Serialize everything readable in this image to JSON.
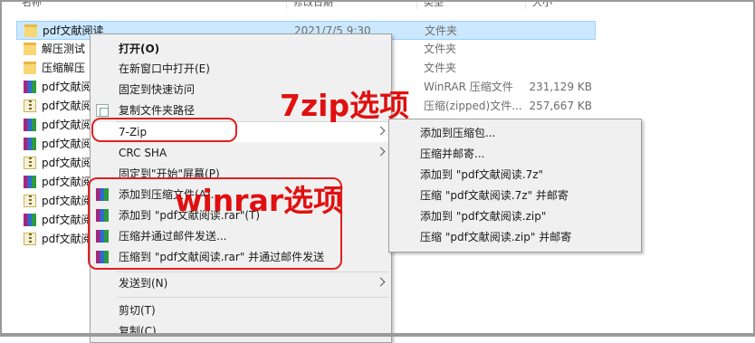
{
  "columns": {
    "name": "名称",
    "date": "修改日期",
    "type": "类型",
    "size": "大小"
  },
  "files": [
    {
      "name": "pdf文献阅读",
      "date": "2021/7/5 9:30",
      "type": "文件夹",
      "size": "",
      "icon": "folder-icon",
      "selected": true
    },
    {
      "name": "解压测试",
      "date": "",
      "type": "文件夹",
      "size": "",
      "icon": "folder-icon"
    },
    {
      "name": "压缩解压",
      "date": "",
      "type": "文件夹",
      "size": "",
      "icon": "folder-icon"
    },
    {
      "name": "pdf文献阅",
      "date": "",
      "type": "WinRAR 压缩文件",
      "size": "231,129 KB",
      "icon": "rar-icon"
    },
    {
      "name": "pdf文献阅",
      "date": "",
      "type": "压缩(zipped)文件...",
      "size": "257,667 KB",
      "icon": "zip-icon"
    },
    {
      "name": "pdf文献阅",
      "date": "",
      "type": "",
      "size": "",
      "icon": "rar-icon"
    },
    {
      "name": "pdf文献阅",
      "date": "",
      "type": "",
      "size": "",
      "icon": "rar-icon"
    },
    {
      "name": "pdf文献阅",
      "date": "",
      "type": "",
      "size": "",
      "icon": "zip-icon"
    },
    {
      "name": "pdf文献阅",
      "date": "",
      "type": "",
      "size": "",
      "icon": "rar-icon"
    },
    {
      "name": "pdf文献阅",
      "date": "",
      "type": "",
      "size": "",
      "icon": "zip-icon"
    },
    {
      "name": "pdf文献阅",
      "date": "",
      "type": "",
      "size": "",
      "icon": "rar-icon"
    },
    {
      "name": "pdf文献阅",
      "date": "",
      "type": "",
      "size": "",
      "icon": "zip-icon"
    }
  ],
  "context_menu": {
    "items": [
      {
        "label": "打开(O)",
        "bold": true
      },
      {
        "label": "在新窗口中打开(E)"
      },
      {
        "label": "固定到快速访问"
      },
      {
        "label": "复制文件夹路径",
        "icon": "copy-document-icon"
      },
      {
        "label": "7-Zip",
        "submenu": true
      },
      {
        "label": "CRC SHA",
        "submenu": true
      },
      {
        "label": "固定到\"开始\"屏幕(P)"
      },
      {
        "label": "添加到压缩文件(A)...",
        "icon": "winrar-icon"
      },
      {
        "label": "添加到 \"pdf文献阅读.rar\"(T)",
        "icon": "winrar-icon"
      },
      {
        "label": "压缩并通过邮件发送...",
        "icon": "winrar-icon"
      },
      {
        "label": "压缩到 \"pdf文献阅读.rar\" 并通过邮件发送",
        "icon": "winrar-icon"
      },
      {
        "label": "发送到(N)",
        "submenu": true
      },
      {
        "label": "剪切(T)"
      },
      {
        "label": "复制(C)"
      }
    ]
  },
  "submenu_7zip": {
    "items": [
      {
        "label": "添加到压缩包..."
      },
      {
        "label": "压缩并邮寄..."
      },
      {
        "label": "添加到 \"pdf文献阅读.7z\""
      },
      {
        "label": "压缩 \"pdf文献阅读.7z\" 并邮寄"
      },
      {
        "label": "添加到 \"pdf文献阅读.zip\""
      },
      {
        "label": "压缩 \"pdf文献阅读.zip\" 并邮寄"
      }
    ]
  },
  "annotations": {
    "zip_label": "7zip选项",
    "winrar_label": "winrar选项",
    "color": "#e01010"
  },
  "colors": {
    "selection": "#cce8ff",
    "menu_bg": "#f0f0f0",
    "annotation": "#e02020"
  }
}
